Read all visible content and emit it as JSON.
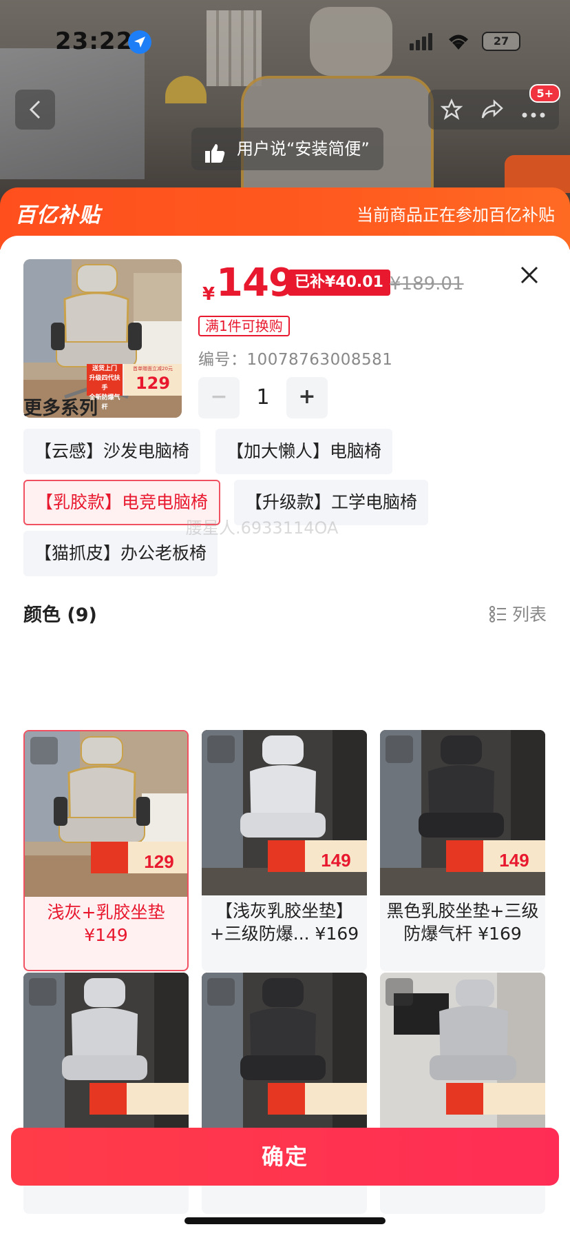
{
  "status_bar": {
    "time": "23:22",
    "battery": "27"
  },
  "review": {
    "text": "用户说“安装简便”"
  },
  "nav": {
    "cart_badge": "5+"
  },
  "subsidy": {
    "logo": "百亿补贴",
    "message": "当前商品正在参加百亿补贴"
  },
  "product": {
    "thumb_tags": {
      "line1": "送货上门",
      "line2": "升级四代扶手",
      "line3": "全新防爆气杆",
      "badge_top": "首单赠面立减20元",
      "badge_price": "129"
    },
    "currency": "¥",
    "price": "149",
    "subsidy_label": "已补¥40.01",
    "original_price": "¥189.01",
    "promo": "满1件可换购",
    "sku_label": "编号：",
    "sku": "10078763008581",
    "quantity": "1",
    "minus": "−",
    "plus": "+"
  },
  "series": {
    "title": "更多系列",
    "items": [
      {
        "label": "【云感】沙发电脑椅"
      },
      {
        "label": "【加大懒人】电脑椅"
      },
      {
        "label": "【乳胶款】电竞电脑椅"
      },
      {
        "label": "【升级款】工学电脑椅"
      },
      {
        "label": "【猫抓皮】办公老板椅"
      }
    ],
    "selected_index": 2
  },
  "watermark": "腰星人.6933114OA",
  "colors": {
    "title": "颜色 (9)",
    "view_label": "列表",
    "items": [
      {
        "label": "浅灰+乳胶坐垫 ¥149",
        "price_tag": "129"
      },
      {
        "label": "【浅灰乳胶坐垫】+三级防爆... ¥169",
        "price_tag": "149"
      },
      {
        "label": "黑色乳胶坐垫+三级防爆气杆 ¥169",
        "price_tag": "149"
      },
      {
        "label": "",
        "price_tag": ""
      },
      {
        "label": "",
        "price_tag": ""
      },
      {
        "label": "",
        "price_tag": ""
      }
    ],
    "selected_index": 0
  },
  "confirm": {
    "label": "确定"
  },
  "colors_palette": {
    "accent": "#e8182e",
    "subsidy": "#ff5a1f",
    "chip_bg": "#f4f5f8"
  }
}
